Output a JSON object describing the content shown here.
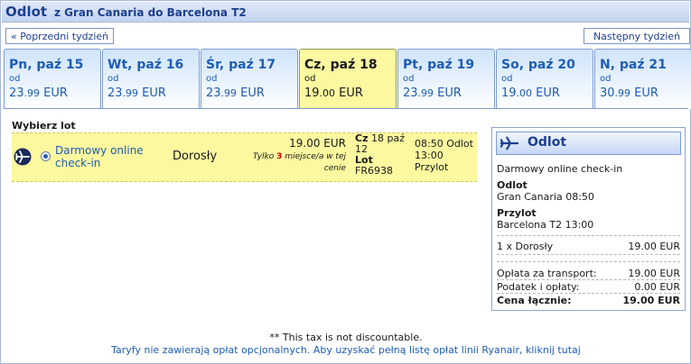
{
  "header": {
    "title": "Odlot",
    "route": "z Gran Canaria do Barcelona T2"
  },
  "nav": {
    "prev_label": "« Poprzedni tydzień",
    "next_label": "Następny tydzień »"
  },
  "tabs": [
    {
      "day": "Pn, paź 15",
      "od": "od",
      "int": "23",
      "dec": ".99",
      "cur": " EUR",
      "selected": false
    },
    {
      "day": "Wt, paź 16",
      "od": "od",
      "int": "23",
      "dec": ".99",
      "cur": " EUR",
      "selected": false
    },
    {
      "day": "Śr, paź 17",
      "od": "od",
      "int": "23",
      "dec": ".99",
      "cur": " EUR",
      "selected": false
    },
    {
      "day": "Cz, paź 18",
      "od": "od",
      "int": "19",
      "dec": ".00",
      "cur": " EUR",
      "selected": true
    },
    {
      "day": "Pt, paź 19",
      "od": "od",
      "int": "23",
      "dec": ".99",
      "cur": " EUR",
      "selected": false
    },
    {
      "day": "So, paź 20",
      "od": "od",
      "int": "19",
      "dec": ".00",
      "cur": " EUR",
      "selected": false
    },
    {
      "day": "N, paź 21",
      "od": "od",
      "int": "30",
      "dec": ".99",
      "cur": " EUR",
      "selected": false
    }
  ],
  "flight": {
    "section_label": "Wybierz lot",
    "fare_type": "Darmowy online check-in",
    "passenger": "Dorosły",
    "price": "19.00 EUR",
    "only_prefix": "Tylko",
    "seats_left": "3",
    "only_suffix": "miejsce/a w tej cenie",
    "date_day": "Cz",
    "date_rest": "18 paź",
    "date_year": "12",
    "flight_label": "Lot",
    "flight_no": "FR6938",
    "dep_time": "08:50",
    "dep_label": "Odlot",
    "arr_time": "13:00",
    "arr_label": "Przylot"
  },
  "summary": {
    "title": "Odlot",
    "fare_type": "Darmowy online check-in",
    "dep_label": "Odlot",
    "dep_value": "Gran Canaria 08:50",
    "arr_label": "Przylot",
    "arr_value": "Barcelona T2 13:00",
    "pax_label": "1 x Dorosły",
    "pax_value": "19.00 EUR",
    "transport_label": "Opłata za transport:",
    "transport_value": "19.00 EUR",
    "tax_label": "Podatek i opłaty:",
    "tax_value": "0.00 EUR",
    "total_label": "Cena łącznie:",
    "total_value": "19.00 EUR"
  },
  "footer": {
    "note": "** This tax is not discountable.",
    "link": "Taryfy nie zawierają opłat opcjonalnych. Aby uzyskać pełną listę opłat linii Ryanair, kliknij tutaj"
  },
  "colors": {
    "accent": "#1d5db5",
    "selected_bg": "#fcf8a0",
    "header_bg": "#c3d3f0"
  },
  "icons": {
    "plane": "plane-icon",
    "radio": "radio-selected-icon"
  }
}
